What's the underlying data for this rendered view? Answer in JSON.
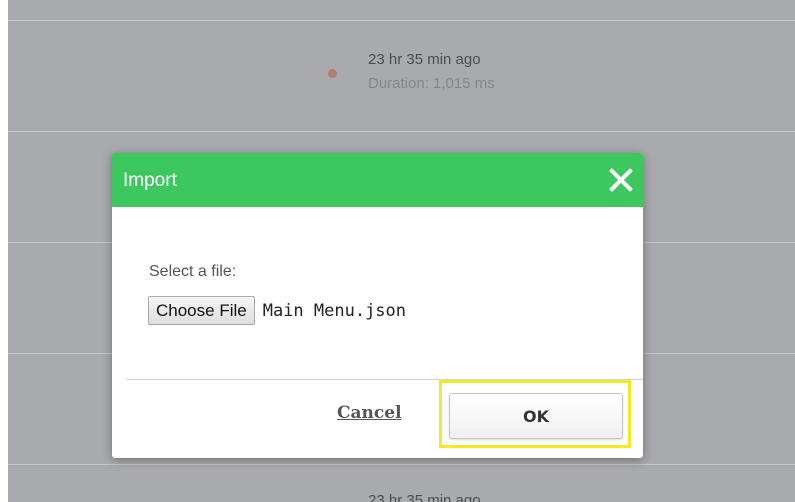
{
  "background": {
    "entries": [
      {
        "when": "23 hr 35 min ago",
        "duration": "Duration: 1,015 ms"
      }
    ],
    "partial_entry_text": "23 hr 35 min ago"
  },
  "dialog": {
    "title": "Import",
    "close_icon": "close-x-icon",
    "select_label": "Select a file:",
    "file_button_label": "Choose File",
    "file_name": "Main Menu.json",
    "cancel_label": "Cancel",
    "ok_label": "OK"
  },
  "colors": {
    "header_green": "#3cc75f",
    "highlight_yellow": "#f3ea22",
    "overlay_gray": "#a9aaae"
  }
}
